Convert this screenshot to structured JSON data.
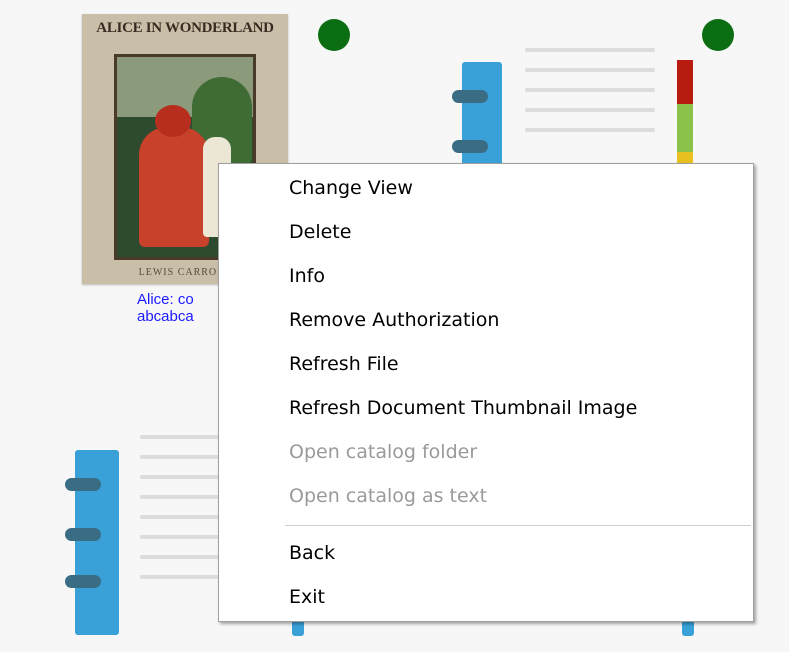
{
  "book": {
    "cover_title": "ALICE IN WONDERLAND",
    "cover_author": "LEWIS CARROLL",
    "caption_line1": "Alice: co",
    "caption_line2": "abcabca"
  },
  "status_colors": {
    "online_dot": "#0b6e12",
    "meter": [
      "#b81c10",
      "#8bc34a",
      "#e8c020"
    ]
  },
  "context_menu": {
    "items": [
      {
        "label": "Change View",
        "enabled": true
      },
      {
        "label": "Delete",
        "enabled": true
      },
      {
        "label": "Info",
        "enabled": true
      },
      {
        "label": "Remove Authorization",
        "enabled": true
      },
      {
        "label": "Refresh File",
        "enabled": true
      },
      {
        "label": "Refresh Document Thumbnail Image",
        "enabled": true
      },
      {
        "label": "Open catalog folder",
        "enabled": false
      },
      {
        "label": "Open catalog as text",
        "enabled": false
      },
      {
        "label": "Back",
        "enabled": true
      },
      {
        "label": "Exit",
        "enabled": true
      }
    ]
  }
}
